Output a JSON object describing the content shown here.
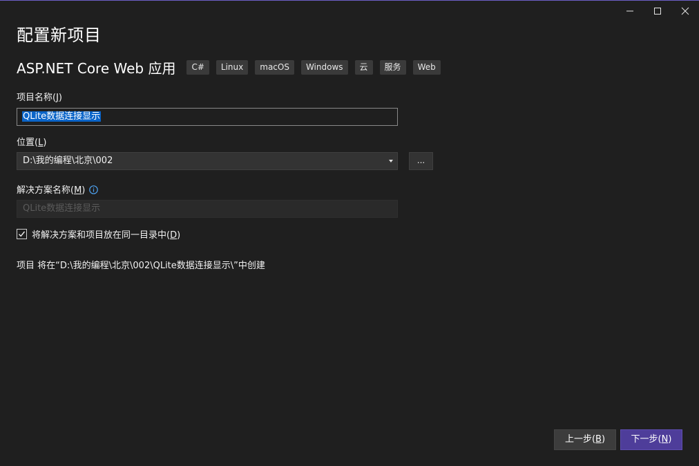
{
  "window": {
    "controls": {
      "minimize_icon": "minimize-icon",
      "maximize_icon": "maximize-icon",
      "close_icon": "close-icon"
    },
    "accent_color": "#6c5fc7"
  },
  "page": {
    "title": "配置新项目"
  },
  "template": {
    "name": "ASP.NET Core Web 应用",
    "tags": [
      "C#",
      "Linux",
      "macOS",
      "Windows",
      "云",
      "服务",
      "Web"
    ]
  },
  "project_name": {
    "label": "项目名称(",
    "accel": "J",
    "label_end": ")",
    "value": "QLite数据连接显示"
  },
  "location": {
    "label": "位置(",
    "accel": "L",
    "label_end": ")",
    "value": "D:\\我的编程\\北京\\002",
    "browse_label": "..."
  },
  "solution_name": {
    "label": "解决方案名称(",
    "accel": "M",
    "label_end": ")",
    "placeholder": "QLite数据连接显示",
    "info_icon": "info-icon"
  },
  "same_dir": {
    "checked": true,
    "label": "将解决方案和项目放在同一目录中(",
    "accel": "D",
    "label_end": ")"
  },
  "path_note": "项目 将在“D:\\我的编程\\北京\\002\\QLite数据连接显示\\”中创建",
  "footer": {
    "back_label": "上一步(",
    "back_accel": "B",
    "back_end": ")",
    "next_label": "下一步(",
    "next_accel": "N",
    "next_end": ")",
    "next_color": "#4e3d9a"
  }
}
